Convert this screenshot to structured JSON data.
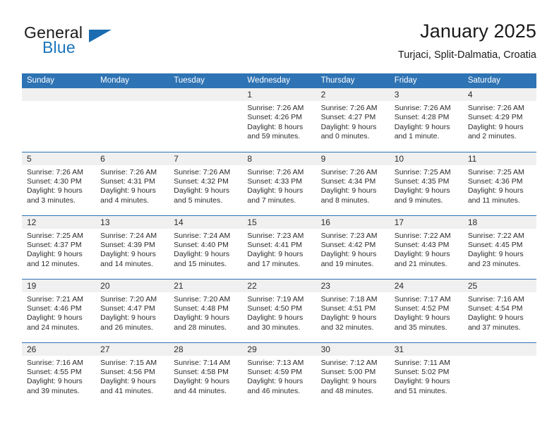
{
  "brand": {
    "name_top": "General",
    "name_bottom": "Blue",
    "accent_color": "#1b75bc",
    "triangle_color": "#1b6cb0",
    "logo_icon": "blue-triangle-icon"
  },
  "header": {
    "title": "January 2025",
    "subtitle": "Turjaci, Split-Dalmatia, Croatia"
  },
  "calendar": {
    "header_bg": "#2e73b4",
    "daynum_bg": "#f0f0f0",
    "weekdays": [
      "Sunday",
      "Monday",
      "Tuesday",
      "Wednesday",
      "Thursday",
      "Friday",
      "Saturday"
    ],
    "weeks": [
      [
        {
          "day": "",
          "sunrise": "",
          "sunset": "",
          "daylight_line1": "",
          "daylight_line2": ""
        },
        {
          "day": "",
          "sunrise": "",
          "sunset": "",
          "daylight_line1": "",
          "daylight_line2": ""
        },
        {
          "day": "",
          "sunrise": "",
          "sunset": "",
          "daylight_line1": "",
          "daylight_line2": ""
        },
        {
          "day": "1",
          "sunrise": "Sunrise: 7:26 AM",
          "sunset": "Sunset: 4:26 PM",
          "daylight_line1": "Daylight: 8 hours",
          "daylight_line2": "and 59 minutes."
        },
        {
          "day": "2",
          "sunrise": "Sunrise: 7:26 AM",
          "sunset": "Sunset: 4:27 PM",
          "daylight_line1": "Daylight: 9 hours",
          "daylight_line2": "and 0 minutes."
        },
        {
          "day": "3",
          "sunrise": "Sunrise: 7:26 AM",
          "sunset": "Sunset: 4:28 PM",
          "daylight_line1": "Daylight: 9 hours",
          "daylight_line2": "and 1 minute."
        },
        {
          "day": "4",
          "sunrise": "Sunrise: 7:26 AM",
          "sunset": "Sunset: 4:29 PM",
          "daylight_line1": "Daylight: 9 hours",
          "daylight_line2": "and 2 minutes."
        }
      ],
      [
        {
          "day": "5",
          "sunrise": "Sunrise: 7:26 AM",
          "sunset": "Sunset: 4:30 PM",
          "daylight_line1": "Daylight: 9 hours",
          "daylight_line2": "and 3 minutes."
        },
        {
          "day": "6",
          "sunrise": "Sunrise: 7:26 AM",
          "sunset": "Sunset: 4:31 PM",
          "daylight_line1": "Daylight: 9 hours",
          "daylight_line2": "and 4 minutes."
        },
        {
          "day": "7",
          "sunrise": "Sunrise: 7:26 AM",
          "sunset": "Sunset: 4:32 PM",
          "daylight_line1": "Daylight: 9 hours",
          "daylight_line2": "and 5 minutes."
        },
        {
          "day": "8",
          "sunrise": "Sunrise: 7:26 AM",
          "sunset": "Sunset: 4:33 PM",
          "daylight_line1": "Daylight: 9 hours",
          "daylight_line2": "and 7 minutes."
        },
        {
          "day": "9",
          "sunrise": "Sunrise: 7:26 AM",
          "sunset": "Sunset: 4:34 PM",
          "daylight_line1": "Daylight: 9 hours",
          "daylight_line2": "and 8 minutes."
        },
        {
          "day": "10",
          "sunrise": "Sunrise: 7:25 AM",
          "sunset": "Sunset: 4:35 PM",
          "daylight_line1": "Daylight: 9 hours",
          "daylight_line2": "and 9 minutes."
        },
        {
          "day": "11",
          "sunrise": "Sunrise: 7:25 AM",
          "sunset": "Sunset: 4:36 PM",
          "daylight_line1": "Daylight: 9 hours",
          "daylight_line2": "and 11 minutes."
        }
      ],
      [
        {
          "day": "12",
          "sunrise": "Sunrise: 7:25 AM",
          "sunset": "Sunset: 4:37 PM",
          "daylight_line1": "Daylight: 9 hours",
          "daylight_line2": "and 12 minutes."
        },
        {
          "day": "13",
          "sunrise": "Sunrise: 7:24 AM",
          "sunset": "Sunset: 4:39 PM",
          "daylight_line1": "Daylight: 9 hours",
          "daylight_line2": "and 14 minutes."
        },
        {
          "day": "14",
          "sunrise": "Sunrise: 7:24 AM",
          "sunset": "Sunset: 4:40 PM",
          "daylight_line1": "Daylight: 9 hours",
          "daylight_line2": "and 15 minutes."
        },
        {
          "day": "15",
          "sunrise": "Sunrise: 7:23 AM",
          "sunset": "Sunset: 4:41 PM",
          "daylight_line1": "Daylight: 9 hours",
          "daylight_line2": "and 17 minutes."
        },
        {
          "day": "16",
          "sunrise": "Sunrise: 7:23 AM",
          "sunset": "Sunset: 4:42 PM",
          "daylight_line1": "Daylight: 9 hours",
          "daylight_line2": "and 19 minutes."
        },
        {
          "day": "17",
          "sunrise": "Sunrise: 7:22 AM",
          "sunset": "Sunset: 4:43 PM",
          "daylight_line1": "Daylight: 9 hours",
          "daylight_line2": "and 21 minutes."
        },
        {
          "day": "18",
          "sunrise": "Sunrise: 7:22 AM",
          "sunset": "Sunset: 4:45 PM",
          "daylight_line1": "Daylight: 9 hours",
          "daylight_line2": "and 23 minutes."
        }
      ],
      [
        {
          "day": "19",
          "sunrise": "Sunrise: 7:21 AM",
          "sunset": "Sunset: 4:46 PM",
          "daylight_line1": "Daylight: 9 hours",
          "daylight_line2": "and 24 minutes."
        },
        {
          "day": "20",
          "sunrise": "Sunrise: 7:20 AM",
          "sunset": "Sunset: 4:47 PM",
          "daylight_line1": "Daylight: 9 hours",
          "daylight_line2": "and 26 minutes."
        },
        {
          "day": "21",
          "sunrise": "Sunrise: 7:20 AM",
          "sunset": "Sunset: 4:48 PM",
          "daylight_line1": "Daylight: 9 hours",
          "daylight_line2": "and 28 minutes."
        },
        {
          "day": "22",
          "sunrise": "Sunrise: 7:19 AM",
          "sunset": "Sunset: 4:50 PM",
          "daylight_line1": "Daylight: 9 hours",
          "daylight_line2": "and 30 minutes."
        },
        {
          "day": "23",
          "sunrise": "Sunrise: 7:18 AM",
          "sunset": "Sunset: 4:51 PM",
          "daylight_line1": "Daylight: 9 hours",
          "daylight_line2": "and 32 minutes."
        },
        {
          "day": "24",
          "sunrise": "Sunrise: 7:17 AM",
          "sunset": "Sunset: 4:52 PM",
          "daylight_line1": "Daylight: 9 hours",
          "daylight_line2": "and 35 minutes."
        },
        {
          "day": "25",
          "sunrise": "Sunrise: 7:16 AM",
          "sunset": "Sunset: 4:54 PM",
          "daylight_line1": "Daylight: 9 hours",
          "daylight_line2": "and 37 minutes."
        }
      ],
      [
        {
          "day": "26",
          "sunrise": "Sunrise: 7:16 AM",
          "sunset": "Sunset: 4:55 PM",
          "daylight_line1": "Daylight: 9 hours",
          "daylight_line2": "and 39 minutes."
        },
        {
          "day": "27",
          "sunrise": "Sunrise: 7:15 AM",
          "sunset": "Sunset: 4:56 PM",
          "daylight_line1": "Daylight: 9 hours",
          "daylight_line2": "and 41 minutes."
        },
        {
          "day": "28",
          "sunrise": "Sunrise: 7:14 AM",
          "sunset": "Sunset: 4:58 PM",
          "daylight_line1": "Daylight: 9 hours",
          "daylight_line2": "and 44 minutes."
        },
        {
          "day": "29",
          "sunrise": "Sunrise: 7:13 AM",
          "sunset": "Sunset: 4:59 PM",
          "daylight_line1": "Daylight: 9 hours",
          "daylight_line2": "and 46 minutes."
        },
        {
          "day": "30",
          "sunrise": "Sunrise: 7:12 AM",
          "sunset": "Sunset: 5:00 PM",
          "daylight_line1": "Daylight: 9 hours",
          "daylight_line2": "and 48 minutes."
        },
        {
          "day": "31",
          "sunrise": "Sunrise: 7:11 AM",
          "sunset": "Sunset: 5:02 PM",
          "daylight_line1": "Daylight: 9 hours",
          "daylight_line2": "and 51 minutes."
        },
        {
          "day": "",
          "sunrise": "",
          "sunset": "",
          "daylight_line1": "",
          "daylight_line2": ""
        }
      ]
    ]
  }
}
